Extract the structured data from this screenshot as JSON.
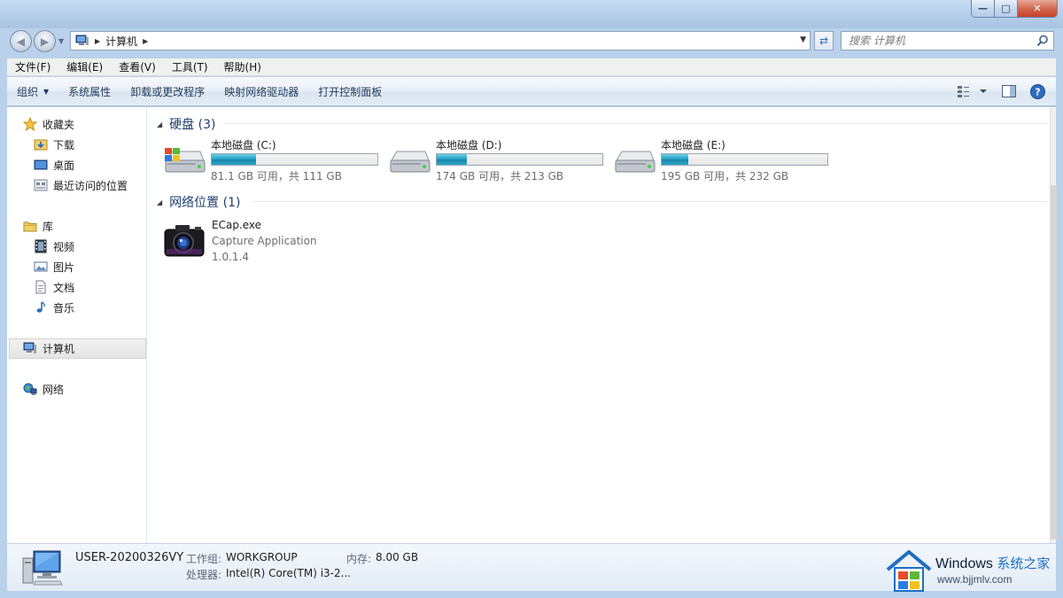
{
  "window": {
    "minimize_glyph": "—",
    "maximize_glyph": "□",
    "close_glyph": "✕"
  },
  "nav": {
    "back_glyph": "◀",
    "forward_glyph": "▶",
    "breadcrumb": [
      "计算机"
    ],
    "search_placeholder": "搜索 计算机"
  },
  "menubar": [
    "文件(F)",
    "编辑(E)",
    "查看(V)",
    "工具(T)",
    "帮助(H)"
  ],
  "commandbar": [
    "组织",
    "系统属性",
    "卸载或更改程序",
    "映射网络驱动器",
    "打开控制面板"
  ],
  "navpane": {
    "favorites": {
      "label": "收藏夹",
      "items": [
        "下载",
        "桌面",
        "最近访问的位置"
      ]
    },
    "libraries": {
      "label": "库",
      "items": [
        "视频",
        "图片",
        "文档",
        "音乐"
      ]
    },
    "computer": "计算机",
    "network": "网络"
  },
  "groups": {
    "hard_disks": "硬盘 (3)",
    "network_locations": "网络位置 (1)"
  },
  "drives": [
    {
      "name": "本地磁盘 (C:)",
      "info": "81.1 GB 可用，共 111 GB",
      "used_fraction": 0.27
    },
    {
      "name": "本地磁盘 (D:)",
      "info": "174 GB 可用，共 213 GB",
      "used_fraction": 0.18
    },
    {
      "name": "本地磁盘 (E:)",
      "info": "195 GB 可用，共 232 GB",
      "used_fraction": 0.16
    }
  ],
  "network_item": {
    "name": "ECap.exe",
    "description": "Capture Application",
    "version": "1.0.1.4"
  },
  "details": {
    "computer_name": "USER-20200326VY",
    "workgroup_label": "工作组:",
    "workgroup_value": "WORKGROUP",
    "memory_label": "内存:",
    "memory_value": "8.00 GB",
    "processor_label": "处理器:",
    "processor_value": "Intel(R) Core(TM) i3-2..."
  },
  "watermark": {
    "brand": "Windows",
    "brand_zh": "系统之家",
    "url": "www.bjjmlv.com"
  },
  "colors": {
    "accent": "#1e3f6f",
    "drive_bar": "#27a3c4"
  }
}
